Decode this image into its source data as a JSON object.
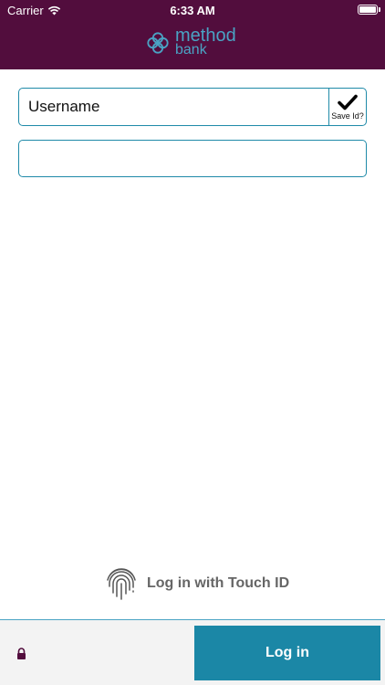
{
  "status_bar": {
    "carrier": "Carrier",
    "time": "6:33 AM"
  },
  "header": {
    "logo_line1": "method",
    "logo_line2": "bank",
    "logo_icon": "method-bank-logo-icon"
  },
  "login_form": {
    "username_placeholder": "Username",
    "save_id_label": "Save Id?",
    "save_id_checked": true,
    "password_placeholder": ""
  },
  "touch_id": {
    "label": "Log in with Touch ID",
    "icon": "fingerprint-icon"
  },
  "footer": {
    "login_label": "Log in",
    "lock_icon": "lock-icon"
  },
  "colors": {
    "brand": "#520d3d",
    "accent": "#1b87a6",
    "logo": "#4aa3c4"
  }
}
